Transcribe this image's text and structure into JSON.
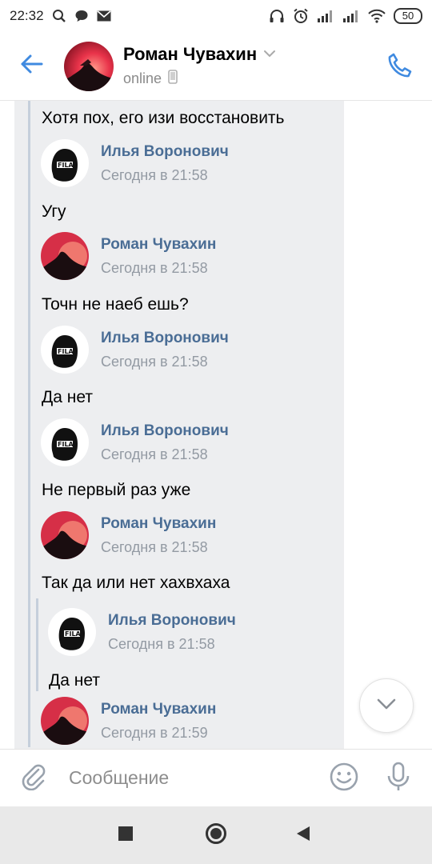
{
  "status_bar": {
    "time": "22:32",
    "battery": "50"
  },
  "header": {
    "name": "Роман Чувахин",
    "status": "online",
    "icons": [
      "back-arrow-icon",
      "chevron-down-icon",
      "phone-device-icon",
      "phone-call-icon"
    ]
  },
  "messages": [
    {
      "type": "text",
      "text": "Хотя пох, его изи восстановить"
    },
    {
      "type": "forward_header",
      "author": "Илья Воронович",
      "time": "Сегодня в 21:58",
      "avatar": "fila"
    },
    {
      "type": "text",
      "text": "Угу"
    },
    {
      "type": "forward_header",
      "author": "Роман Чувахин",
      "time": "Сегодня в 21:58",
      "avatar": "sunset"
    },
    {
      "type": "text",
      "text": "Точн не наеб ешь?"
    },
    {
      "type": "forward_header",
      "author": "Илья Воронович",
      "time": "Сегодня в 21:58",
      "avatar": "fila"
    },
    {
      "type": "text",
      "text": "Да нет"
    },
    {
      "type": "forward_header",
      "author": "Илья Воронович",
      "time": "Сегодня в 21:58",
      "avatar": "fila"
    },
    {
      "type": "text",
      "text": "Не первый раз уже"
    },
    {
      "type": "forward_header",
      "author": "Роман Чувахин",
      "time": "Сегодня в 21:58",
      "avatar": "sunset"
    },
    {
      "type": "text",
      "text": "Так да или нет хахвхаха"
    },
    {
      "type": "forward_header",
      "author": "Илья Воронович",
      "time": "Сегодня в 21:58",
      "avatar": "fila",
      "nested": true
    },
    {
      "type": "text",
      "text": "Да нет",
      "nested": true
    },
    {
      "type": "forward_header",
      "author": "Роман Чувахин",
      "time": "Сегодня в 21:59",
      "avatar": "sunset"
    }
  ],
  "composer": {
    "placeholder": "Сообщение"
  },
  "colors": {
    "accent": "#3f8ae0",
    "author_name": "#4a6d95",
    "bubble_bg": "#edeef0",
    "forward_line": "#c5cfdb"
  }
}
